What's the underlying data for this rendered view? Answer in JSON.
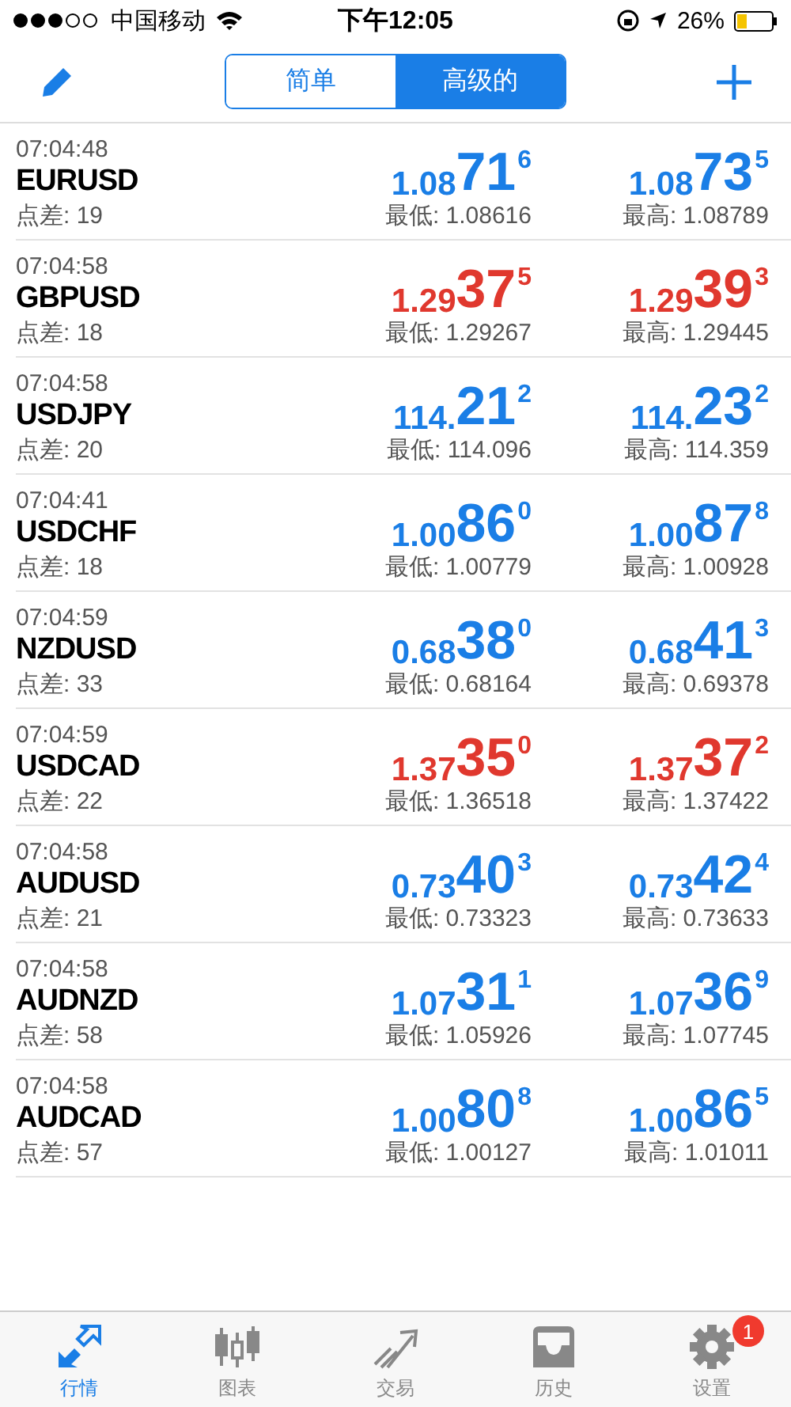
{
  "status_bar": {
    "carrier": "中国移动",
    "time": "下午12:05",
    "battery": "26%"
  },
  "segments": [
    {
      "label": "简单",
      "selected": false
    },
    {
      "label": "高级的",
      "selected": true
    }
  ],
  "quotes": [
    {
      "time": "07:04:48",
      "symbol": "EURUSD",
      "spread": "点差: 19",
      "color": "#1a7ee6",
      "bid": {
        "head": "1.08",
        "big": "71",
        "tail": "6"
      },
      "ask": {
        "head": "1.08",
        "big": "73",
        "tail": "5"
      },
      "low": "最低: 1.08616",
      "high": "最高: 1.08789"
    },
    {
      "time": "07:04:58",
      "symbol": "GBPUSD",
      "spread": "点差: 18",
      "color": "#e0382e",
      "bid": {
        "head": "1.29",
        "big": "37",
        "tail": "5"
      },
      "ask": {
        "head": "1.29",
        "big": "39",
        "tail": "3"
      },
      "low": "最低: 1.29267",
      "high": "最高: 1.29445"
    },
    {
      "time": "07:04:58",
      "symbol": "USDJPY",
      "spread": "点差: 20",
      "color": "#1a7ee6",
      "bid": {
        "head": "114.",
        "big": "21",
        "tail": "2"
      },
      "ask": {
        "head": "114.",
        "big": "23",
        "tail": "2"
      },
      "low": "最低: 114.096",
      "high": "最高: 114.359"
    },
    {
      "time": "07:04:41",
      "symbol": "USDCHF",
      "spread": "点差: 18",
      "color": "#1a7ee6",
      "bid": {
        "head": "1.00",
        "big": "86",
        "tail": "0"
      },
      "ask": {
        "head": "1.00",
        "big": "87",
        "tail": "8"
      },
      "low": "最低: 1.00779",
      "high": "最高: 1.00928"
    },
    {
      "time": "07:04:59",
      "symbol": "NZDUSD",
      "spread": "点差: 33",
      "color": "#1a7ee6",
      "bid": {
        "head": "0.68",
        "big": "38",
        "tail": "0"
      },
      "ask": {
        "head": "0.68",
        "big": "41",
        "tail": "3"
      },
      "low": "最低: 0.68164",
      "high": "最高: 0.69378"
    },
    {
      "time": "07:04:59",
      "symbol": "USDCAD",
      "spread": "点差: 22",
      "color": "#e0382e",
      "bid": {
        "head": "1.37",
        "big": "35",
        "tail": "0"
      },
      "ask": {
        "head": "1.37",
        "big": "37",
        "tail": "2"
      },
      "low": "最低: 1.36518",
      "high": "最高: 1.37422"
    },
    {
      "time": "07:04:58",
      "symbol": "AUDUSD",
      "spread": "点差: 21",
      "color": "#1a7ee6",
      "bid": {
        "head": "0.73",
        "big": "40",
        "tail": "3"
      },
      "ask": {
        "head": "0.73",
        "big": "42",
        "tail": "4"
      },
      "low": "最低: 0.73323",
      "high": "最高: 0.73633"
    },
    {
      "time": "07:04:58",
      "symbol": "AUDNZD",
      "spread": "点差: 58",
      "color": "#1a7ee6",
      "bid": {
        "head": "1.07",
        "big": "31",
        "tail": "1"
      },
      "ask": {
        "head": "1.07",
        "big": "36",
        "tail": "9"
      },
      "low": "最低: 1.05926",
      "high": "最高: 1.07745"
    },
    {
      "time": "07:04:58",
      "symbol": "AUDCAD",
      "spread": "点差: 57",
      "color": "#1a7ee6",
      "bid": {
        "head": "1.00",
        "big": "80",
        "tail": "8"
      },
      "ask": {
        "head": "1.00",
        "big": "86",
        "tail": "5"
      },
      "low": "最低: 1.00127",
      "high": "最高: 1.01011"
    }
  ],
  "tab_bar": [
    {
      "kind": "quotes",
      "label": "行情",
      "selected": true
    },
    {
      "kind": "chart",
      "label": "图表",
      "selected": false
    },
    {
      "kind": "trade",
      "label": "交易",
      "selected": false
    },
    {
      "kind": "history",
      "label": "历史",
      "selected": false
    },
    {
      "kind": "settings",
      "label": "设置",
      "selected": false,
      "badge": "1"
    }
  ]
}
